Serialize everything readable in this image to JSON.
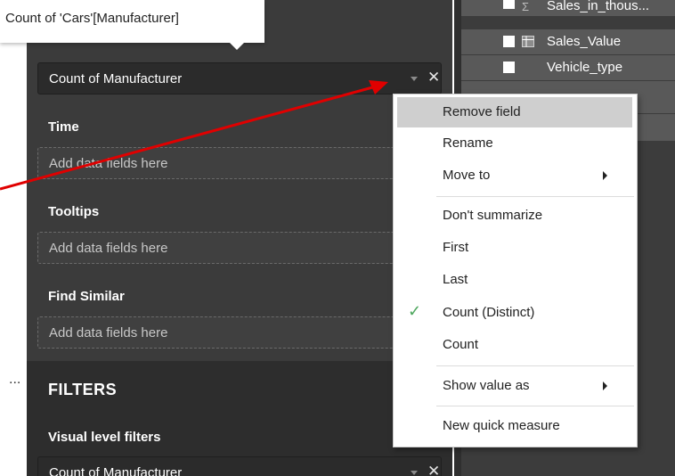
{
  "tooltip": {
    "text": "Count of 'Cars'[Manufacturer]"
  },
  "right_panel": {
    "rows": [
      {
        "label": "Sales_in_thous...",
        "type_icon": "sigma-icon"
      },
      {
        "label": "Sales_Value",
        "type_icon": "table-calc-icon"
      },
      {
        "label": "Vehicle_type",
        "type_icon": ""
      }
    ]
  },
  "fields_pane": {
    "value_well": "Count of Manufacturer",
    "sections": [
      {
        "label": "Time",
        "placeholder": "Add data fields here"
      },
      {
        "label": "Tooltips",
        "placeholder": "Add data fields here"
      },
      {
        "label": "Find Similar",
        "placeholder": "Add data fields here"
      }
    ],
    "more_dots": "...",
    "filters_title": "FILTERS",
    "visual_level_filters_label": "Visual level filters",
    "filter_chip": "Count of Manufacturer"
  },
  "context_menu": {
    "items": [
      {
        "label": "Remove field",
        "hovered": true
      },
      {
        "label": "Rename"
      },
      {
        "label": "Move to",
        "submenu": true
      },
      {
        "label": "Don't summarize"
      },
      {
        "label": "First"
      },
      {
        "label": "Last"
      },
      {
        "label": "Count (Distinct)",
        "checked": true
      },
      {
        "label": "Count"
      },
      {
        "label": "Show value as",
        "submenu": true
      },
      {
        "label": "New quick measure"
      }
    ]
  },
  "colors": {
    "pane_bg": "#3b3b3b",
    "menu_hover": "#cfcfcf",
    "checkmark": "#4fa85f",
    "annotation_arrow": "#e00000"
  }
}
